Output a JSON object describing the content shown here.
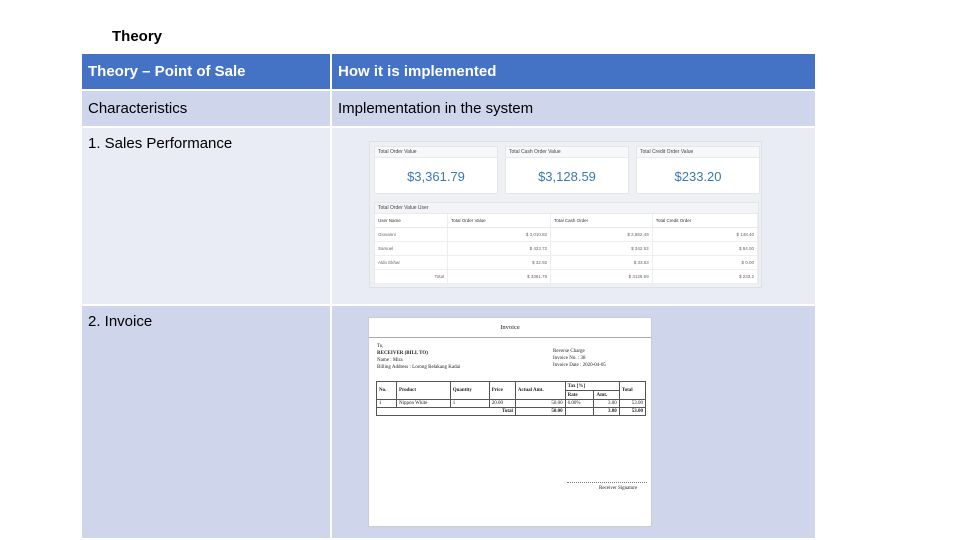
{
  "slide": {
    "title": "Theory"
  },
  "table": {
    "header": {
      "col1": "Theory – Point of Sale",
      "col2": "How it is implemented"
    },
    "subheader": {
      "col1": "Characteristics",
      "col2": "Implementation in the system"
    },
    "rows": [
      {
        "label": "1. Sales Performance"
      },
      {
        "label": "2. Invoice"
      }
    ]
  },
  "colors": {
    "header_blue": "#4472c4",
    "row_dark": "#cfd5ea",
    "row_light": "#e9ebf5",
    "value_blue": "#3a78b5"
  },
  "sales_screenshot": {
    "cards": [
      {
        "label": "Total Order Value",
        "value": "$3,361.79"
      },
      {
        "label": "Total Cash Order Value",
        "value": "$3,128.59"
      },
      {
        "label": "Total Credit Order Value",
        "value": "$233.20"
      }
    ],
    "table_title": "Total Order Value User",
    "columns": [
      "User Name",
      "Total Order Value",
      "Total Cash Order",
      "Total Credit Order"
    ],
    "rows": [
      [
        "Giovanni",
        "$ 3,010.82",
        "$ 2,852.49",
        "$ 148.40"
      ],
      [
        "Samuel",
        "$ 423.72",
        "$ 342.53",
        "$ 84.00"
      ],
      [
        "Aldo Ekhar",
        "$ 32.92",
        "$ 33.53",
        "$ 0.00"
      ]
    ],
    "total_row": [
      "Total",
      "$ 3361.79",
      "$ 3128.59",
      "$ 233.2"
    ]
  },
  "invoice_screenshot": {
    "title": "Invoice",
    "to_label": "To,",
    "receiver": "RECEIVER (BILL TO)",
    "name": "Name : Mira",
    "billing": "Billing Address : Lorong Belakang Kadai",
    "meta": [
      "Reverse Charge",
      "Invoice No. : 38",
      "Invoice Date : 2020-04-05"
    ],
    "columns": [
      "No.",
      "Product",
      "Quantity",
      "Price",
      "Actual Amt.",
      "Tax [%]",
      "Total"
    ],
    "tax_sub": [
      "Rate",
      "Amt."
    ],
    "item": [
      "1",
      "Nippon White",
      "1",
      "20.00",
      "50.00",
      "6.00%",
      "3.00",
      "53.00"
    ],
    "total_row": [
      "Total",
      "50.00",
      "3.00",
      "53.00"
    ],
    "signature": "Receiver Signature"
  }
}
